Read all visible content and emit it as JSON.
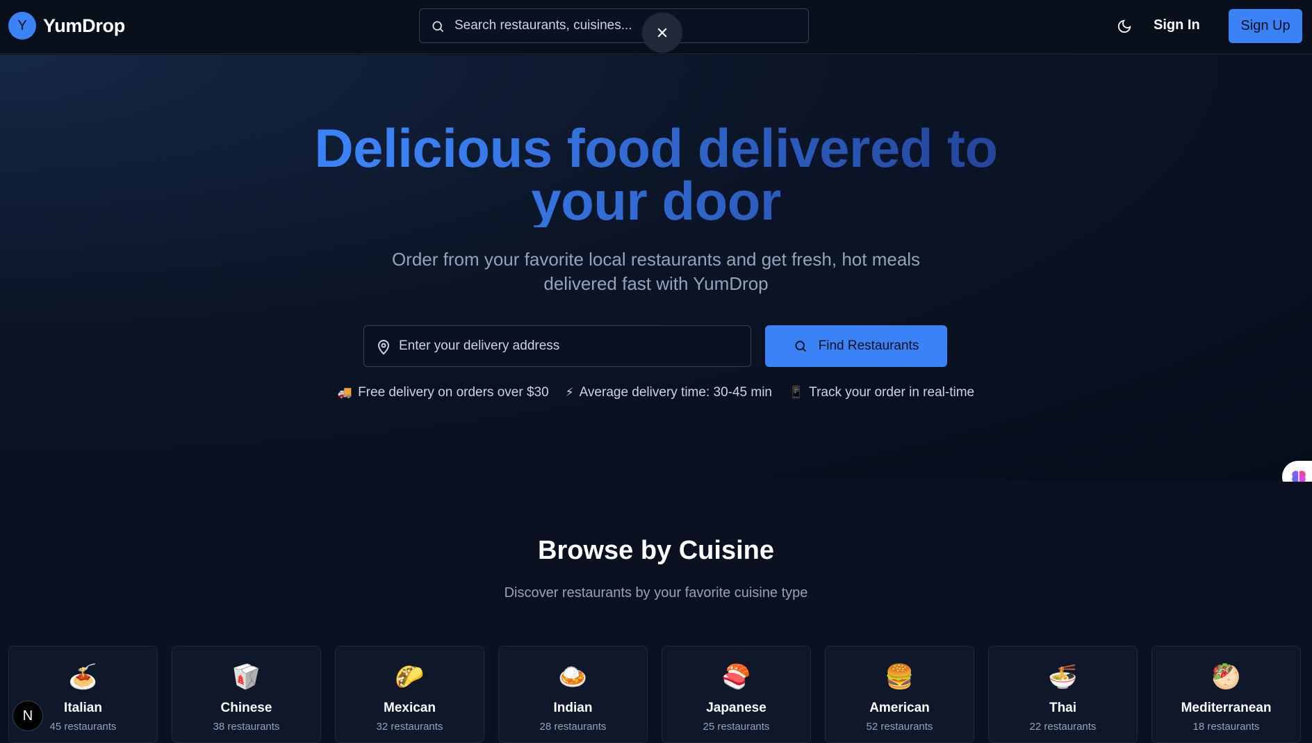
{
  "header": {
    "logo_letter": "Y",
    "brand": "YumDrop",
    "search_placeholder": "Search restaurants, cuisines...",
    "sign_in": "Sign In",
    "sign_up": "Sign Up"
  },
  "hero": {
    "title_line1": "Delicious food delivered to",
    "title_line2": "your door",
    "subtitle": "Order from your favorite local restaurants and get fresh, hot meals delivered fast with YumDrop",
    "address_placeholder": "Enter your delivery address",
    "find_button": "Find Restaurants",
    "features": [
      {
        "icon": "🚚",
        "text": "Free delivery on orders over $30"
      },
      {
        "icon": "⚡",
        "text": "Average delivery time: 30-45 min"
      },
      {
        "icon": "📱",
        "text": "Track your order in real-time"
      }
    ]
  },
  "cuisines": {
    "title": "Browse by Cuisine",
    "subtitle": "Discover restaurants by your favorite cuisine type",
    "items": [
      {
        "emoji": "🍝",
        "name": "Italian",
        "count": "45 restaurants"
      },
      {
        "emoji": "🥡",
        "name": "Chinese",
        "count": "38 restaurants"
      },
      {
        "emoji": "🌮",
        "name": "Mexican",
        "count": "32 restaurants"
      },
      {
        "emoji": "🍛",
        "name": "Indian",
        "count": "28 restaurants"
      },
      {
        "emoji": "🍣",
        "name": "Japanese",
        "count": "25 restaurants"
      },
      {
        "emoji": "🍔",
        "name": "American",
        "count": "52 restaurants"
      },
      {
        "emoji": "🍜",
        "name": "Thai",
        "count": "22 restaurants"
      },
      {
        "emoji": "🥙",
        "name": "Mediterranean",
        "count": "18 restaurants"
      }
    ]
  },
  "dev_badge": "N",
  "colors": {
    "accent": "#3b82f6",
    "background": "#0b1120",
    "muted_text": "#94a3b8"
  }
}
